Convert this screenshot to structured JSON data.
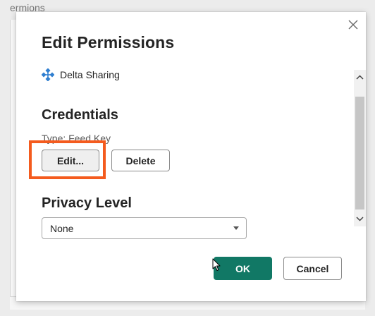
{
  "background": {
    "partial_text": "ermions"
  },
  "dialog": {
    "title": "Edit Permissions",
    "source": {
      "icon": "delta-sharing-icon",
      "name": "Delta Sharing"
    },
    "credentials": {
      "heading": "Credentials",
      "type_text": "Type: Feed Key",
      "edit_label": "Edit...",
      "delete_label": "Delete"
    },
    "privacy": {
      "heading": "Privacy Level",
      "selected": "None"
    },
    "ok_label": "OK",
    "cancel_label": "Cancel"
  },
  "colors": {
    "primary": "#117865",
    "highlight": "#f45b1e",
    "icon": "#2f7fd0"
  }
}
